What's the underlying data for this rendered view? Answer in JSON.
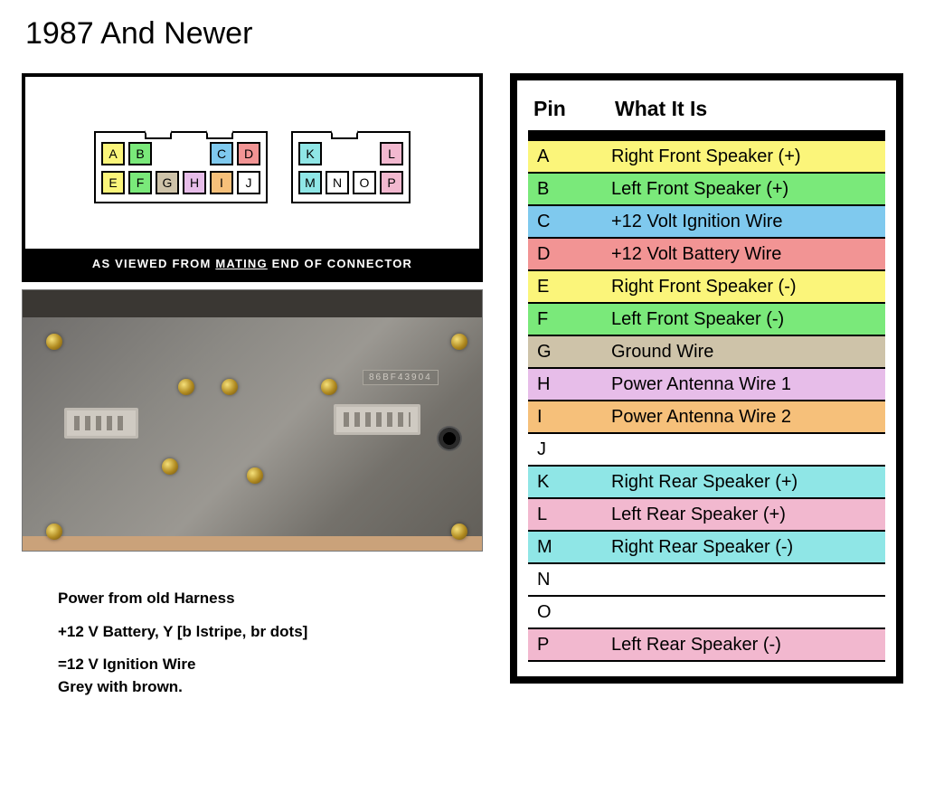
{
  "title": "1987 And Newer",
  "mating": {
    "prefix": "AS VIEWED FROM ",
    "em": "MATING",
    "suffix": " END OF CONNECTOR"
  },
  "conn_large": {
    "notches": [
      56,
      124
    ],
    "cells": [
      {
        "l": "A",
        "color": "#fbf57a"
      },
      {
        "l": "B",
        "color": "#7ae97a"
      },
      {
        "l": "",
        "blank": true
      },
      {
        "l": "",
        "blank": true
      },
      {
        "l": "C",
        "color": "#7fc9ee"
      },
      {
        "l": "D",
        "color": "#f29494"
      },
      {
        "l": "E",
        "color": "#fbf57a"
      },
      {
        "l": "F",
        "color": "#7ae97a"
      },
      {
        "l": "G",
        "color": "#cec3a9"
      },
      {
        "l": "H",
        "color": "#e7bde9"
      },
      {
        "l": "I",
        "color": "#f6c07a"
      },
      {
        "l": "J",
        "color": "#ffffff"
      }
    ]
  },
  "conn_small": {
    "notches": [
      44
    ],
    "cells": [
      {
        "l": "K",
        "color": "#8fe6e6"
      },
      {
        "l": "",
        "blank": true
      },
      {
        "l": "",
        "blank": true
      },
      {
        "l": "L",
        "color": "#f2b8cf"
      },
      {
        "l": "M",
        "color": "#8fe6e6"
      },
      {
        "l": "N",
        "color": "#ffffff"
      },
      {
        "l": "O",
        "color": "#ffffff"
      },
      {
        "l": "P",
        "color": "#f2b8cf"
      }
    ]
  },
  "radio": {
    "screws": [
      {
        "t": 48,
        "l": 26
      },
      {
        "t": 48,
        "l": 474
      },
      {
        "t": 258,
        "l": 26
      },
      {
        "t": 258,
        "l": 474
      },
      {
        "t": 98,
        "l": 172
      },
      {
        "t": 98,
        "l": 220
      },
      {
        "t": 98,
        "l": 330
      },
      {
        "t": 186,
        "l": 154
      },
      {
        "t": 196,
        "l": 248
      }
    ],
    "plugs": [
      {
        "t": 130,
        "l": 46,
        "w": 82
      },
      {
        "t": 126,
        "l": 344,
        "w": 96
      }
    ],
    "jack": {
      "t": 150,
      "l": 458
    },
    "pn": {
      "t": 88,
      "l": 376,
      "text": "86BF43904"
    }
  },
  "colors": {
    "yellow": "#fbf57a",
    "green": "#7ae97a",
    "blue": "#7fc9ee",
    "red": "#f29494",
    "tan": "#cec3a9",
    "lilac": "#e7bde9",
    "orange": "#f6c07a",
    "white": "#ffffff",
    "cyan": "#8fe6e6",
    "pink": "#f2b8cf"
  },
  "pin_table": {
    "head_pin": "Pin",
    "head_what": "What It Is",
    "rows": [
      {
        "pin": "A",
        "what": "Right Front Speaker (+)",
        "color": "yellow"
      },
      {
        "pin": "B",
        "what": "Left Front Speaker (+)",
        "color": "green"
      },
      {
        "pin": "C",
        "what": "+12 Volt Ignition Wire",
        "color": "blue"
      },
      {
        "pin": "D",
        "what": "+12 Volt Battery Wire",
        "color": "red"
      },
      {
        "pin": "E",
        "what": "Right Front Speaker (-)",
        "color": "yellow"
      },
      {
        "pin": "F",
        "what": "Left Front Speaker (-)",
        "color": "green"
      },
      {
        "pin": "G",
        "what": "Ground Wire",
        "color": "tan"
      },
      {
        "pin": "H",
        "what": "Power Antenna Wire 1",
        "color": "lilac"
      },
      {
        "pin": "I",
        "what": "Power Antenna Wire 2",
        "color": "orange"
      },
      {
        "pin": "J",
        "what": "",
        "color": "white"
      },
      {
        "pin": "K",
        "what": "Right Rear Speaker (+)",
        "color": "cyan"
      },
      {
        "pin": "L",
        "what": "Left Rear Speaker (+)",
        "color": "pink"
      },
      {
        "pin": "M",
        "what": "Right Rear Speaker (-)",
        "color": "cyan"
      },
      {
        "pin": "N",
        "what": "",
        "color": "white"
      },
      {
        "pin": "O",
        "what": "",
        "color": "white"
      },
      {
        "pin": "P",
        "what": "Left Rear Speaker (-)",
        "color": "pink"
      }
    ]
  },
  "notes": {
    "l1": "Power from old Harness",
    "l2": "+12 V Battery, Y [b lstripe, br dots]",
    "l3": "=12 V Ignition Wire",
    "l4": "Grey with brown."
  }
}
